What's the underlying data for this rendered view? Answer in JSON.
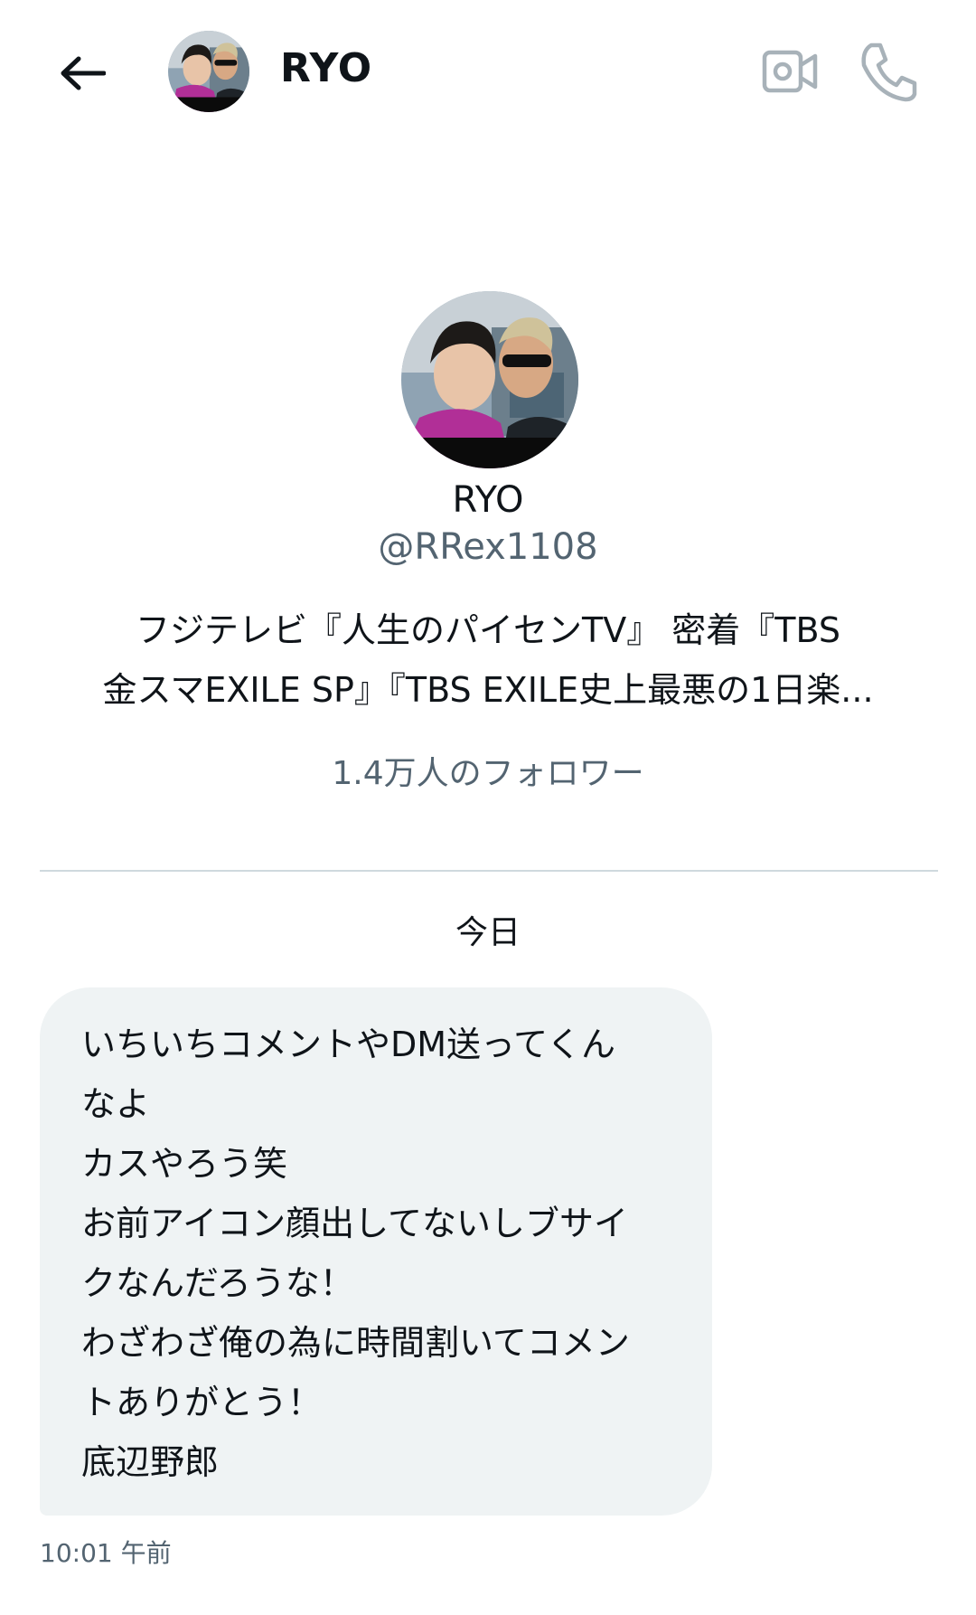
{
  "header": {
    "name": "RYO"
  },
  "profile": {
    "name": "RYO",
    "handle": "@RRex1108",
    "bio_lines": [
      "フジテレビ『人生のパイセンTV』 密着『TBS",
      "金スマEXILE SP』『TBS EXILE史上最悪の1日楽..."
    ],
    "followers": "1.4万人のフォロワー"
  },
  "conversation": {
    "date_label": "今日",
    "message_lines": [
      "いちいちコメントやDM送ってくん",
      "なよ",
      "カスやろう笑",
      "お前アイコン顔出してないしブサイ",
      "クなんだろうな！",
      "わざわざ俺の為に時間割いてコメン",
      "トありがとう！",
      "底辺野郎"
    ],
    "timestamp": "10:01 午前"
  },
  "icons": {
    "back": "arrow-left-icon",
    "video": "video-camera-icon",
    "call": "phone-icon"
  },
  "colors": {
    "text_primary": "#0f1419",
    "text_secondary": "#536471",
    "bubble_bg": "#eff3f4",
    "divider": "#cfd9de",
    "icon_gray": "#a8b2b9"
  }
}
